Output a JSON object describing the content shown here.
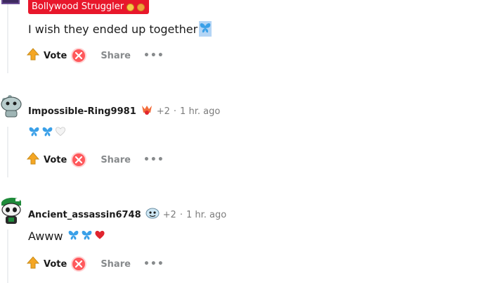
{
  "comments": [
    {
      "flair": "Bollywood Struggler",
      "body": "I wish they ended up together",
      "vote_label": "Vote",
      "share_label": "Share"
    },
    {
      "author": "Impossible-Ring9981",
      "karma": "+2",
      "separator": "·",
      "time": "1 hr. ago",
      "vote_label": "Vote",
      "share_label": "Share"
    },
    {
      "author": "Ancient_assassin6748",
      "karma": "+2",
      "separator": "·",
      "time": "1 hr. ago",
      "body": "Awww",
      "vote_label": "Vote",
      "share_label": "Share"
    }
  ],
  "icons": {
    "upvote": "upvote-arrow-icon",
    "downvote": "downvote-x-icon",
    "more": "more-options-icon",
    "butterfly": "butterfly-emoji-icon",
    "heart_white": "white-heart-emoji-icon",
    "heart_red": "red-heart-emoji-icon"
  },
  "colors": {
    "flair_bg": "#e8172b",
    "upvote": "#f5a623",
    "downvote": "#ff585b",
    "butterfly": "#3aa0e8",
    "heart_red": "#e0242e"
  }
}
